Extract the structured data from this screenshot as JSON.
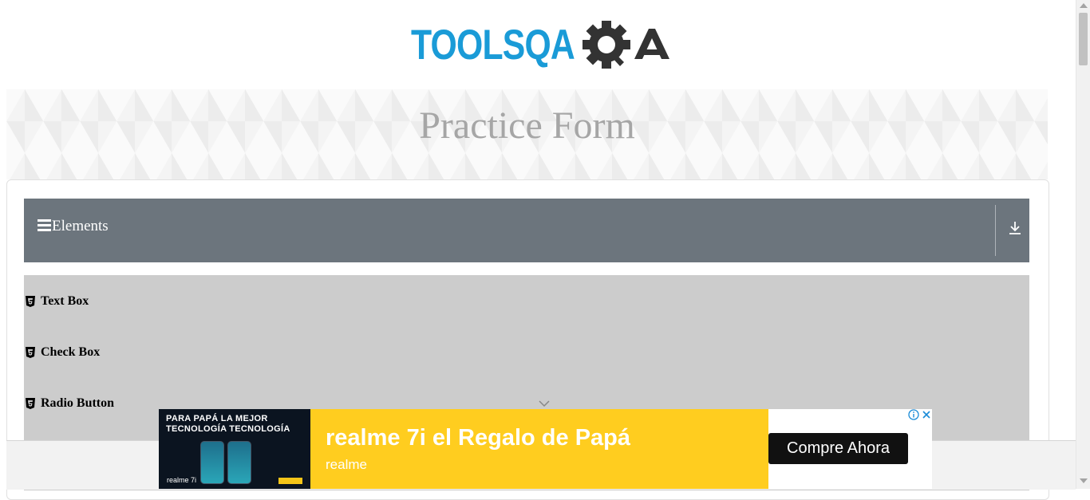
{
  "header": {
    "logo_text": "TOOLSQA",
    "page_title": "Practice Form"
  },
  "sidebar": {
    "group_title": "Elements",
    "items": [
      {
        "label": "Text Box"
      },
      {
        "label": "Check Box"
      },
      {
        "label": "Radio Button"
      }
    ]
  },
  "ad": {
    "image_headline_line1": "PARA PAPÁ LA MEJOR",
    "image_headline_line2": "TECNOLOGÍA TECNOLOGÍA",
    "image_brand": "realme 7i",
    "headline": "realme 7i el Regalo de Papá",
    "advertiser": "realme",
    "cta": "Compre Ahora"
  },
  "colors": {
    "logo_blue": "#1a9bd7",
    "logo_dark": "#333333",
    "group_header_bg": "#6c757d",
    "list_bg": "#cccccc",
    "ad_yellow": "#ffcd1f"
  },
  "icons": [
    "menu-icon",
    "download-icon",
    "html5-icon",
    "chevron-down-icon",
    "info-icon",
    "close-icon"
  ]
}
